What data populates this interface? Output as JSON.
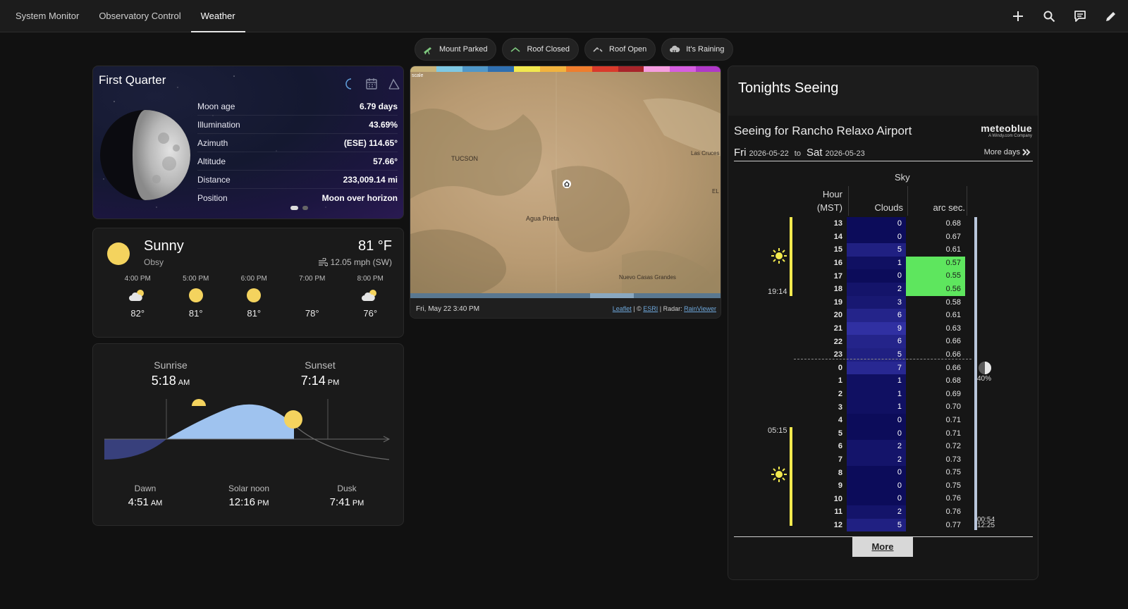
{
  "nav": {
    "tabs": [
      {
        "label": "System Monitor"
      },
      {
        "label": "Observatory Control"
      },
      {
        "label": "Weather"
      }
    ]
  },
  "chips": [
    {
      "label": "Mount Parked"
    },
    {
      "label": "Roof Closed"
    },
    {
      "label": "Roof Open"
    },
    {
      "label": "It's Raining"
    }
  ],
  "moon": {
    "title": "First Quarter",
    "rows": [
      {
        "label": "Moon age",
        "value": "6.79 days"
      },
      {
        "label": "Illumination",
        "value": "43.69%"
      },
      {
        "label": "Azimuth",
        "value": "(ESE) 114.65°"
      },
      {
        "label": "Altitude",
        "value": "57.66°"
      },
      {
        "label": "Distance",
        "value": "233,009.14 mi"
      },
      {
        "label": "Position",
        "value": "Moon over horizon"
      }
    ]
  },
  "weather": {
    "condition": "Sunny",
    "location": "Obsy",
    "temperature": "81 °F",
    "wind": "12.05 mph (SW)",
    "forecast": [
      {
        "time": "4:00 PM",
        "icon": "partly-cloudy-icon",
        "temp": "82°"
      },
      {
        "time": "5:00 PM",
        "icon": "sunny-icon",
        "temp": "81°"
      },
      {
        "time": "6:00 PM",
        "icon": "sunny-icon",
        "temp": "81°"
      },
      {
        "time": "7:00 PM",
        "icon": "night-clear-icon",
        "temp": "78°"
      },
      {
        "time": "8:00 PM",
        "icon": "partly-cloudy-icon",
        "temp": "76°"
      }
    ]
  },
  "sun": {
    "sunrise_label": "Sunrise",
    "sunrise_time": "5:18",
    "sunrise_ampm": "AM",
    "sunset_label": "Sunset",
    "sunset_time": "7:14",
    "sunset_ampm": "PM",
    "dawn_label": "Dawn",
    "dawn_time": "4:51",
    "dawn_ampm": "AM",
    "noon_label": "Solar noon",
    "noon_time": "12:16",
    "noon_ampm": "PM",
    "dusk_label": "Dusk",
    "dusk_time": "7:41",
    "dusk_ampm": "PM"
  },
  "map": {
    "scale_label": "scale",
    "cities": [
      "TUCSON",
      "Agua Prieta",
      "Las Cruces",
      "EL",
      "Nuevo Casas Grandes"
    ],
    "timestamp": "Fri, May 22 3:40 PM",
    "attr_leaflet": "Leaflet",
    "attr_sep1": " | © ",
    "attr_esri": "ESRI",
    "attr_sep2": " | Radar: ",
    "attr_radar": "RainViewer",
    "progress": 0.6,
    "colors": [
      "#c8b27a",
      "#7ec8e3",
      "#4f97c9",
      "#2f6fb0",
      "#f2e94e",
      "#f2b33d",
      "#ef7d2d",
      "#d93a2b",
      "#a8242a",
      "#f59de0",
      "#d65ee0",
      "#b038c8"
    ]
  },
  "seeing": {
    "title": "Tonights Seeing",
    "heading": "Seeing for Rancho Relaxo Airport",
    "brand": "meteoblue",
    "brand_sub": "A Windy.com Company",
    "from_day": "Fri",
    "from_date": "2026-05-22",
    "to_word": "to",
    "to_day": "Sat",
    "to_date": "2026-05-23",
    "more_days": "More days",
    "sky_header": "Sky",
    "hour_header_1": "Hour",
    "hour_header_2": "(MST)",
    "clouds_header": "Clouds",
    "arcsec_header": "arc sec.",
    "sunset_time": "19:14",
    "sunrise_time": "05:15",
    "moon_illum": "40%",
    "moon_times_1": "00:54",
    "moon_times_2": "12:25",
    "more_button": "More",
    "rows": [
      {
        "hour": "13",
        "clouds": 0,
        "seeing": "0.68",
        "good": false
      },
      {
        "hour": "14",
        "clouds": 0,
        "seeing": "0.67",
        "good": false
      },
      {
        "hour": "15",
        "clouds": 5,
        "seeing": "0.61",
        "good": false
      },
      {
        "hour": "16",
        "clouds": 1,
        "seeing": "0.57",
        "good": true
      },
      {
        "hour": "17",
        "clouds": 0,
        "seeing": "0.55",
        "good": true
      },
      {
        "hour": "18",
        "clouds": 2,
        "seeing": "0.56",
        "good": true
      },
      {
        "hour": "19",
        "clouds": 3,
        "seeing": "0.58",
        "good": false
      },
      {
        "hour": "20",
        "clouds": 6,
        "seeing": "0.61",
        "good": false
      },
      {
        "hour": "21",
        "clouds": 9,
        "seeing": "0.63",
        "good": false
      },
      {
        "hour": "22",
        "clouds": 6,
        "seeing": "0.66",
        "good": false
      },
      {
        "hour": "23",
        "clouds": 5,
        "seeing": "0.66",
        "good": false
      },
      {
        "hour": "0",
        "clouds": 7,
        "seeing": "0.66",
        "good": false
      },
      {
        "hour": "1",
        "clouds": 1,
        "seeing": "0.68",
        "good": false
      },
      {
        "hour": "2",
        "clouds": 1,
        "seeing": "0.69",
        "good": false
      },
      {
        "hour": "3",
        "clouds": 1,
        "seeing": "0.70",
        "good": false
      },
      {
        "hour": "4",
        "clouds": 0,
        "seeing": "0.71",
        "good": false
      },
      {
        "hour": "5",
        "clouds": 0,
        "seeing": "0.71",
        "good": false
      },
      {
        "hour": "6",
        "clouds": 2,
        "seeing": "0.72",
        "good": false
      },
      {
        "hour": "7",
        "clouds": 2,
        "seeing": "0.73",
        "good": false
      },
      {
        "hour": "8",
        "clouds": 0,
        "seeing": "0.75",
        "good": false
      },
      {
        "hour": "9",
        "clouds": 0,
        "seeing": "0.75",
        "good": false
      },
      {
        "hour": "10",
        "clouds": 0,
        "seeing": "0.76",
        "good": false
      },
      {
        "hour": "11",
        "clouds": 2,
        "seeing": "0.76",
        "good": false
      },
      {
        "hour": "12",
        "clouds": 5,
        "seeing": "0.77",
        "good": false
      }
    ]
  }
}
